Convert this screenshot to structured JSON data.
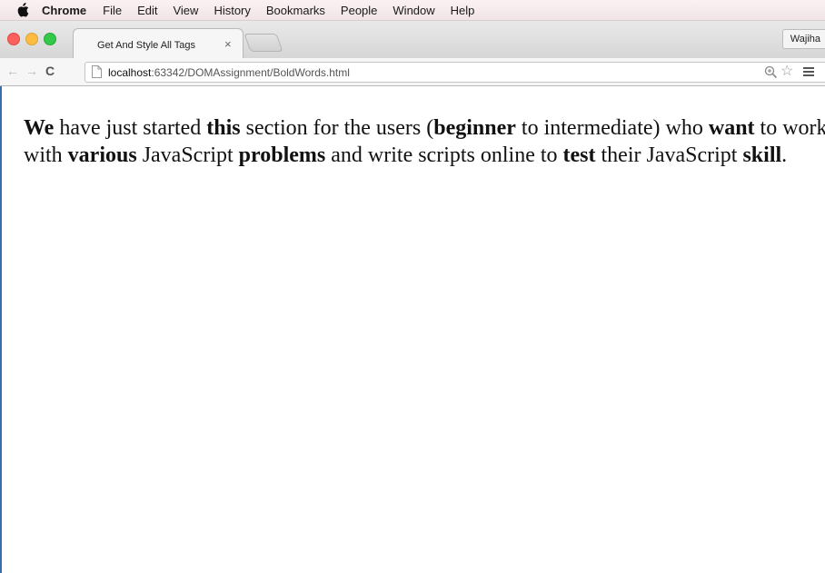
{
  "menubar": {
    "app_name": "Chrome",
    "items": [
      "File",
      "Edit",
      "View",
      "History",
      "Bookmarks",
      "People",
      "Window",
      "Help"
    ]
  },
  "tab": {
    "title": "Get And Style All Tags",
    "close_glyph": "×"
  },
  "profile": {
    "name": "Wajiha"
  },
  "toolbar": {
    "url_host": "localhost",
    "url_rest": ":63342/DOMAssignment/BoldWords.html"
  },
  "paragraph": {
    "segments": [
      {
        "text": "We",
        "bold": true
      },
      {
        "text": " have just started ",
        "bold": false
      },
      {
        "text": "this",
        "bold": true
      },
      {
        "text": " section for the users (",
        "bold": false
      },
      {
        "text": "beginner",
        "bold": true
      },
      {
        "text": " to intermediate) who ",
        "bold": false
      },
      {
        "text": "want",
        "bold": true
      },
      {
        "text": " to work with ",
        "bold": false
      },
      {
        "text": "various",
        "bold": true
      },
      {
        "text": " JavaScript ",
        "bold": false
      },
      {
        "text": "problems",
        "bold": true
      },
      {
        "text": " and write scripts online to ",
        "bold": false
      },
      {
        "text": "test",
        "bold": true
      },
      {
        "text": " their JavaScript ",
        "bold": false
      },
      {
        "text": "skill",
        "bold": true
      },
      {
        "text": ".",
        "bold": false
      }
    ]
  },
  "colors": {
    "traffic_red": "#fc605c",
    "traffic_yellow": "#fdbc40",
    "traffic_green": "#34c84a",
    "window_edge": "#3b6ea8"
  },
  "icons": [
    "apple-icon",
    "back-icon",
    "forward-icon",
    "reload-icon",
    "page-icon",
    "zoom-icon",
    "star-icon",
    "menu-icon"
  ]
}
